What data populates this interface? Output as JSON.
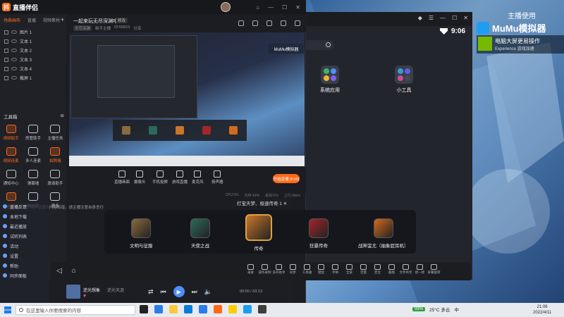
{
  "companion": {
    "app_name": "直播伴侣",
    "window_controls": [
      "⌂",
      "—",
      "☐",
      "✕"
    ],
    "sidebar_tabs": [
      "场景画布",
      "直播",
      "视频素材"
    ],
    "scenes": [
      "图片 1",
      "文本 1",
      "文本 2",
      "文本 3",
      "文本 4",
      "截屏 1"
    ],
    "toolbox_title": "工具箱",
    "toolbox_items": [
      {
        "label": "视频助手",
        "hot": true
      },
      {
        "label": "房管助手",
        "hot": false
      },
      {
        "label": "主播任务",
        "hot": false
      },
      {
        "label": "视频连麦",
        "hot": true
      },
      {
        "label": "多人连麦",
        "hot": false
      },
      {
        "label": "拍照墙",
        "hot": true
      },
      {
        "label": "通知中心",
        "hot": false
      },
      {
        "label": "弹幕墙",
        "hot": false
      },
      {
        "label": "邀请助手",
        "hot": false
      },
      {
        "label": "礼物",
        "hot": true
      },
      {
        "label": "粉丝团",
        "hot": false
      },
      {
        "label": "更多",
        "hot": false
      }
    ],
    "notice": "主播你好，为了保护直播间内容和谐，请主播注意自身言行",
    "room_title": "一起来玩无尽深渊吧",
    "room_tag": "修改",
    "room_meta": [
      "无尽深渊",
      "新手主播",
      "ID:55819",
      "分享"
    ],
    "action_items": [
      "直播画面",
      "摄像头",
      "手机投屏",
      "游戏直播",
      "麦克风",
      "扬声器"
    ],
    "start_live_label": "开始直播 (F10)",
    "stats": [
      "CPU:5%",
      "内存:43%",
      "丢帧:0%",
      "上行:0kb/s"
    ],
    "chat_items": [
      "直播反馈",
      "本地下载",
      "最近播放",
      "试听列表",
      "活动",
      "设置",
      "帮助",
      "同步面板"
    ]
  },
  "mumu": {
    "window_controls": [
      "◆",
      "☰",
      "—",
      "☐",
      "✕"
    ],
    "time": "9:06",
    "folders": [
      {
        "label": "系统应用",
        "colors": [
          "#3bb56c",
          "#4e8ef7",
          "#f2b632",
          "#7a63f0"
        ]
      },
      {
        "label": "小工具",
        "colors": [
          "#3a9bd8",
          "#5b5ef2",
          "#d04a9b",
          "#444a55"
        ]
      }
    ],
    "nav_tools": [
      "录屏",
      "操作录制",
      "多开助手",
      "同步",
      "工具箱",
      "键鼠",
      "手柄",
      "全屏",
      "音量",
      "定位",
      "截图",
      "文件共享",
      "摇一摇",
      "屏幕旋转"
    ]
  },
  "games": {
    "tooltip": "打宝天梦、极速传奇 1 ✕",
    "items": [
      {
        "label": "文明与征服",
        "color": "#8a6a3e",
        "big": false
      },
      {
        "label": "天使之战",
        "color": "#2a6a5a",
        "big": false
      },
      {
        "label": "传奇",
        "color": "#c8762a",
        "big": true
      },
      {
        "label": "狂暴传奇",
        "color": "#a4252a",
        "big": false
      },
      {
        "label": "战神蚩尤（抽象屁耳机）",
        "color": "#d46a1e",
        "big": false
      }
    ]
  },
  "music": {
    "title": "逆光想象",
    "artist": "逆光天涯",
    "time": "00:00 / 03:13"
  },
  "overlay": {
    "label": "主播使用",
    "brand": "MuMu模拟器",
    "nv_line1": "电脑大屏更易操作",
    "nv_line2": "Experience 游戏加速"
  },
  "taskbar": {
    "search_placeholder": "在这里输入你要搜索的内容",
    "apps_colors": [
      "#222",
      "#2b7de9",
      "#ffc83d",
      "#0a7cd8",
      "#2b7de9",
      "#ff6a1a",
      "#ffcc00",
      "#1f9ef0",
      "#3e3e3e"
    ],
    "battery": "99%",
    "weather": "25°C 多云",
    "ime": "中",
    "time": "21:06",
    "date": "2022/4/11"
  }
}
